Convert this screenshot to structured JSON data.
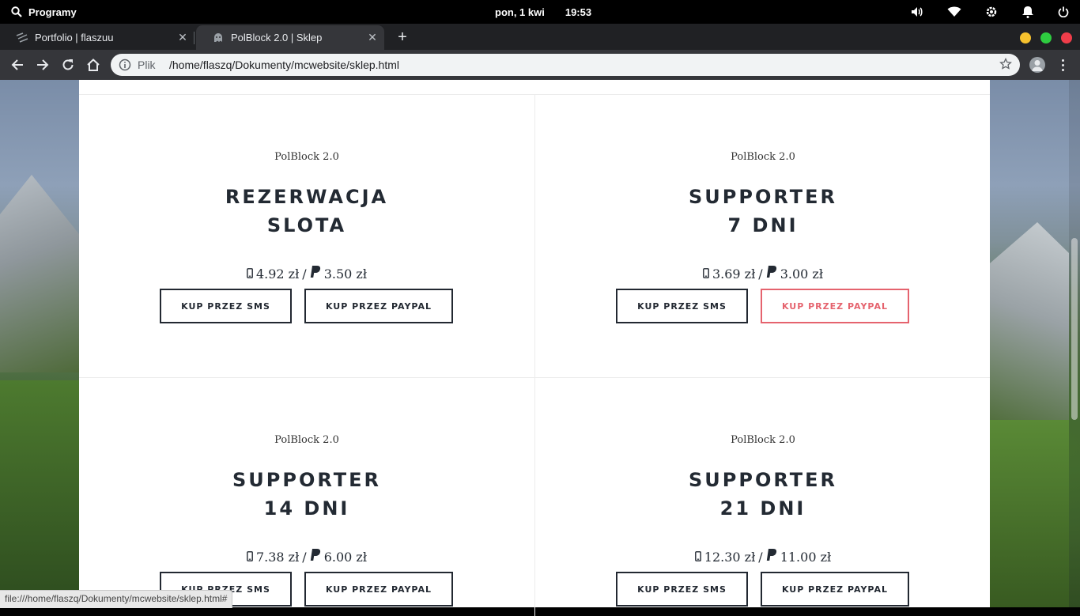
{
  "system": {
    "apps_label": "Programy",
    "date": "pon, 1 kwi",
    "time": "19:53"
  },
  "tabs": [
    {
      "title": "Portfolio | flaszuu",
      "active": false
    },
    {
      "title": "PolBlock 2.0 | Sklep",
      "active": true
    }
  ],
  "address_bar": {
    "scheme_label": "Plik",
    "url": "/home/flaszq/Dokumenty/mcwebsite/sklep.html"
  },
  "status_url": "file:///home/flaszq/Dokumenty/mcwebsite/sklep.html#",
  "colors": {
    "accent": "#e5636e",
    "text_dark": "#222831"
  },
  "shop": {
    "products": [
      {
        "brand": "PolBlock 2.0",
        "title_line1": "REZERWACJA",
        "title_line2": "SLOTA",
        "sms_price": "4.92 zł",
        "separator": "/",
        "paypal_price": "3.50 zł",
        "sms_button": "KUP PRZEZ SMS",
        "paypal_button": "KUP PRZEZ PAYPAL"
      },
      {
        "brand": "PolBlock 2.0",
        "title_line1": "SUPPORTER",
        "title_line2": "7 DNI",
        "sms_price": "3.69 zł",
        "separator": "/",
        "paypal_price": "3.00 zł",
        "sms_button": "KUP PRZEZ SMS",
        "paypal_button": "KUP PRZEZ PAYPAL"
      },
      {
        "brand": "PolBlock 2.0",
        "title_line1": "SUPPORTER",
        "title_line2": "14 DNI",
        "sms_price": "7.38 zł",
        "separator": "/",
        "paypal_price": "6.00 zł",
        "sms_button": "KUP PRZEZ SMS",
        "paypal_button": "KUP PRZEZ PAYPAL"
      },
      {
        "brand": "PolBlock 2.0",
        "title_line1": "SUPPORTER",
        "title_line2": "21 DNI",
        "sms_price": "12.30 zł",
        "separator": "/",
        "paypal_price": "11.00 zł",
        "sms_button": "KUP PRZEZ SMS",
        "paypal_button": "KUP PRZEZ PAYPAL"
      }
    ]
  }
}
